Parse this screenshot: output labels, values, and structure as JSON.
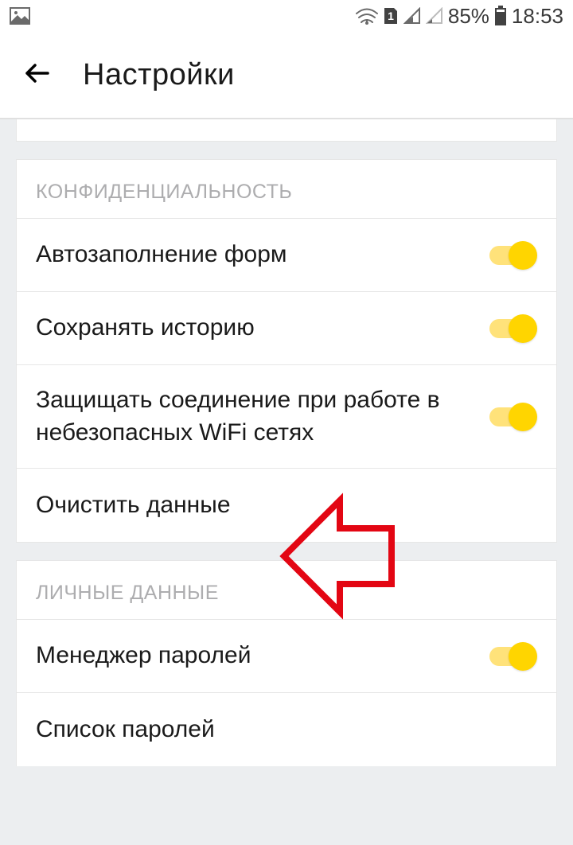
{
  "status": {
    "battery_percent": "85%",
    "time": "18:53",
    "sim_label": "1"
  },
  "header": {
    "title": "Настройки"
  },
  "sections": {
    "privacy": {
      "title": "КОНФИДЕНЦИАЛЬНОСТЬ",
      "items": {
        "autofill": "Автозаполнение форм",
        "save_history": "Сохранять историю",
        "protect_wifi": "Защищать соединение при работе в небезопасных WiFi сетях",
        "clear_data": "Очистить данные"
      }
    },
    "personal": {
      "title": "ЛИЧНЫЕ ДАННЫЕ",
      "items": {
        "password_manager": "Менеджер паролей",
        "password_list": "Список паролей"
      }
    }
  }
}
